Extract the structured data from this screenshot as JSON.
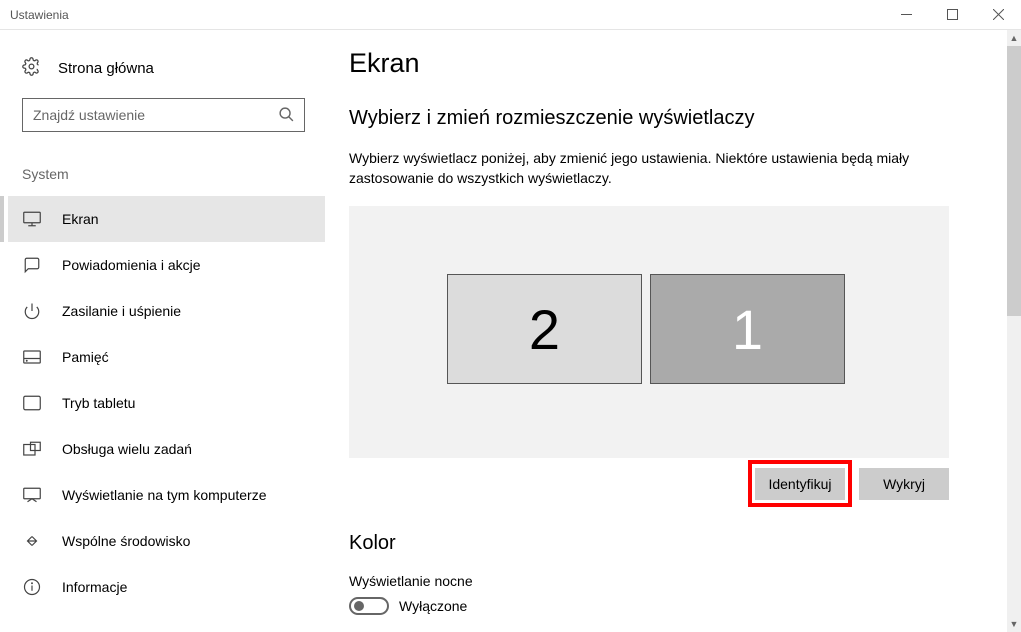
{
  "window": {
    "title": "Ustawienia"
  },
  "sidebar": {
    "home": "Strona główna",
    "search_placeholder": "Znajdź ustawienie",
    "category": "System",
    "items": [
      {
        "label": "Ekran",
        "icon": "monitor"
      },
      {
        "label": "Powiadomienia i akcje",
        "icon": "message"
      },
      {
        "label": "Zasilanie i uśpienie",
        "icon": "power"
      },
      {
        "label": "Pamięć",
        "icon": "storage"
      },
      {
        "label": "Tryb tabletu",
        "icon": "tablet"
      },
      {
        "label": "Obsługa wielu zadań",
        "icon": "multitask"
      },
      {
        "label": "Wyświetlanie na tym komputerze",
        "icon": "project"
      },
      {
        "label": "Wspólne środowisko",
        "icon": "shared"
      },
      {
        "label": "Informacje",
        "icon": "info"
      }
    ]
  },
  "main": {
    "heading": "Ekran",
    "subheading1": "Wybierz i zmień rozmieszczenie wyświetlaczy",
    "desc": "Wybierz wyświetlacz poniżej, aby zmienić jego ustawienia. Niektóre ustawienia będą miały zastosowanie do wszystkich wyświetlaczy.",
    "display2": "2",
    "display1": "1",
    "identify_btn": "Identyfikuj",
    "detect_btn": "Wykryj",
    "color_heading": "Kolor",
    "nightlight_label": "Wyświetlanie nocne",
    "nightlight_state": "Wyłączone"
  }
}
